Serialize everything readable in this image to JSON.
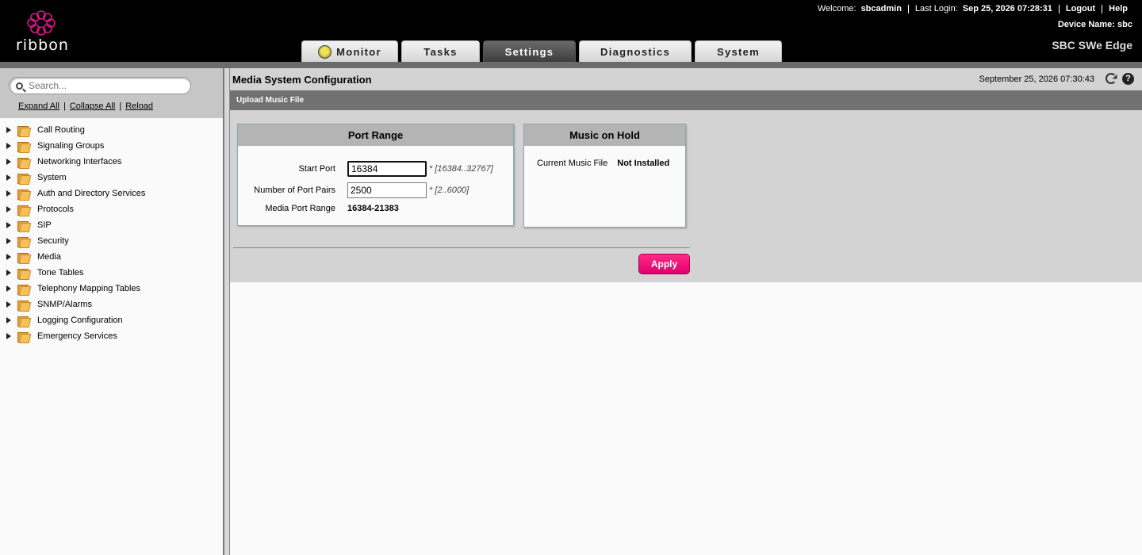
{
  "header": {
    "logo_text": "ribbon",
    "welcome_label": "Welcome:",
    "username": "sbcadmin",
    "last_login_label": "Last Login:",
    "last_login_value": "Sep 25, 2026 07:28:31",
    "logout": "Logout",
    "help": "Help",
    "device_name_label": "Device Name:",
    "device_name_value": "sbc",
    "product": "SBC SWe Edge",
    "tabs": [
      {
        "label": "Monitor",
        "active": false
      },
      {
        "label": "Tasks",
        "active": false
      },
      {
        "label": "Settings",
        "active": true
      },
      {
        "label": "Diagnostics",
        "active": false
      },
      {
        "label": "System",
        "active": false
      }
    ]
  },
  "sidebar": {
    "search_placeholder": "Search...",
    "expand_all": "Expand All",
    "collapse_all": "Collapse All",
    "reload": "Reload",
    "items": [
      {
        "label": "Call Routing"
      },
      {
        "label": "Signaling Groups"
      },
      {
        "label": "Networking Interfaces"
      },
      {
        "label": "System"
      },
      {
        "label": "Auth and Directory Services"
      },
      {
        "label": "Protocols"
      },
      {
        "label": "SIP"
      },
      {
        "label": "Security"
      },
      {
        "label": "Media"
      },
      {
        "label": "Tone Tables"
      },
      {
        "label": "Telephony Mapping Tables"
      },
      {
        "label": "SNMP/Alarms"
      },
      {
        "label": "Logging Configuration"
      },
      {
        "label": "Emergency Services"
      }
    ]
  },
  "main": {
    "title": "Media System Configuration",
    "timestamp": "September 25, 2026 07:30:43",
    "action_label": "Upload Music File",
    "port_range": {
      "heading": "Port Range",
      "start_port_label": "Start Port",
      "start_port_value": "16384",
      "start_port_hint": "* [16384..32767]",
      "port_pairs_label": "Number of Port Pairs",
      "port_pairs_value": "2500",
      "port_pairs_hint": "* [2..6000]",
      "media_range_label": "Media Port Range",
      "media_range_value": "16384-21383"
    },
    "music_on_hold": {
      "heading": "Music on Hold",
      "current_file_label": "Current Music File",
      "current_file_value": "Not Installed"
    },
    "apply_label": "Apply"
  },
  "colors": {
    "accent": "#e8007a",
    "header_bg": "#000000",
    "panel_head": "#b4b4b4"
  }
}
